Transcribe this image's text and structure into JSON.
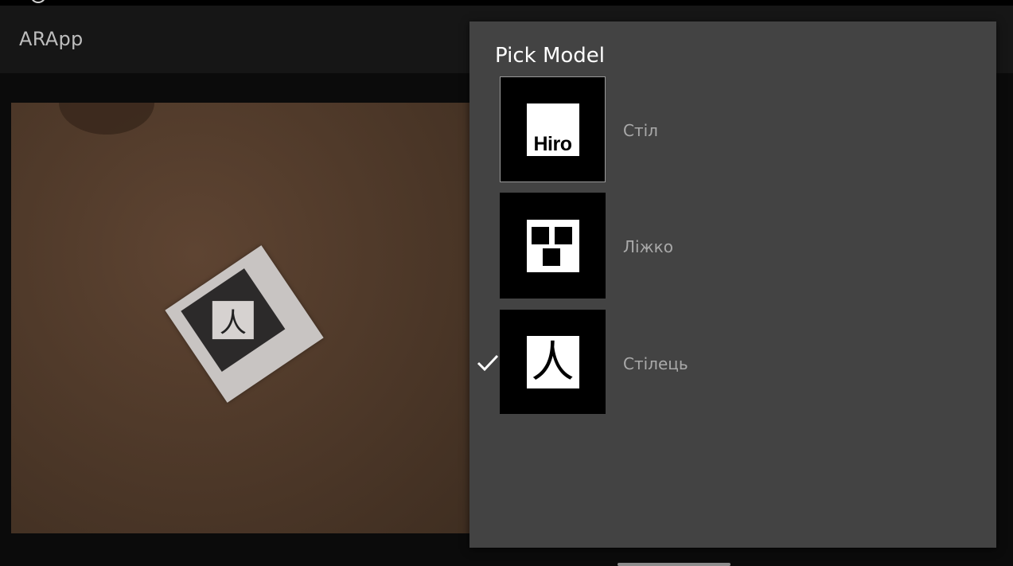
{
  "app": {
    "title": "ARApp"
  },
  "dialog": {
    "title": "Pick Model",
    "items": [
      {
        "label": "Стіл",
        "marker": "Hiro",
        "selected": false
      },
      {
        "label": "Ліжко",
        "marker": "",
        "selected": false
      },
      {
        "label": "Стілець",
        "marker": "人",
        "selected": true
      }
    ]
  },
  "camera": {
    "marker_glyph": "人"
  },
  "icons": {
    "check": "check-icon",
    "hiro_marker": "hiro-marker-icon",
    "squares_marker": "squares-marker-icon",
    "kanji_marker": "kanji-marker-icon"
  },
  "colors": {
    "dialog_bg": "#434343",
    "action_bar": "#161616",
    "label": "#a9a9a9"
  }
}
